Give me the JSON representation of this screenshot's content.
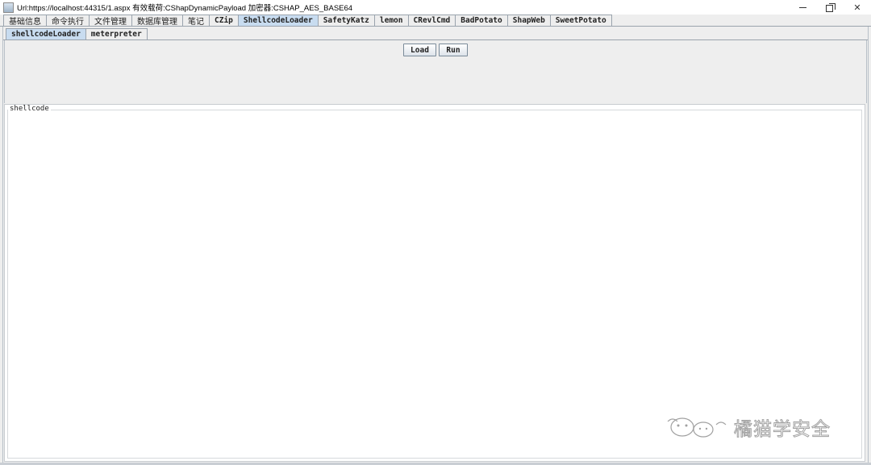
{
  "window": {
    "title": "Url:https://localhost:44315/1.aspx 有效载荷:CShapDynamicPayload 加密器:CSHAP_AES_BASE64",
    "controls": [
      "minimize",
      "restore",
      "close"
    ]
  },
  "main_tabs": [
    {
      "label": "基础信息",
      "active": false,
      "cjk": true
    },
    {
      "label": "命令执行",
      "active": false,
      "cjk": true
    },
    {
      "label": "文件管理",
      "active": false,
      "cjk": true
    },
    {
      "label": "数据库管理",
      "active": false,
      "cjk": true
    },
    {
      "label": "笔记",
      "active": false,
      "cjk": true
    },
    {
      "label": "CZip",
      "active": false,
      "cjk": false
    },
    {
      "label": "ShellcodeLoader",
      "active": true,
      "cjk": false
    },
    {
      "label": "SafetyKatz",
      "active": false,
      "cjk": false
    },
    {
      "label": "lemon",
      "active": false,
      "cjk": false
    },
    {
      "label": "CRevlCmd",
      "active": false,
      "cjk": false
    },
    {
      "label": "BadPotato",
      "active": false,
      "cjk": false
    },
    {
      "label": "ShapWeb",
      "active": false,
      "cjk": false
    },
    {
      "label": "SweetPotato",
      "active": false,
      "cjk": false
    }
  ],
  "sub_tabs": [
    {
      "label": "shellcodeLoader",
      "active": true
    },
    {
      "label": "meterpreter",
      "active": false
    }
  ],
  "buttons": {
    "load_label": "Load",
    "run_label": "Run"
  },
  "shellcode_panel": {
    "title": "shellcode",
    "value": ""
  },
  "watermark": {
    "text": "橘猫学安全"
  },
  "colors": {
    "active_tab": "#c8dcf0",
    "panel_bg": "#eeeeee",
    "text_area_bg": "#ffffff"
  }
}
